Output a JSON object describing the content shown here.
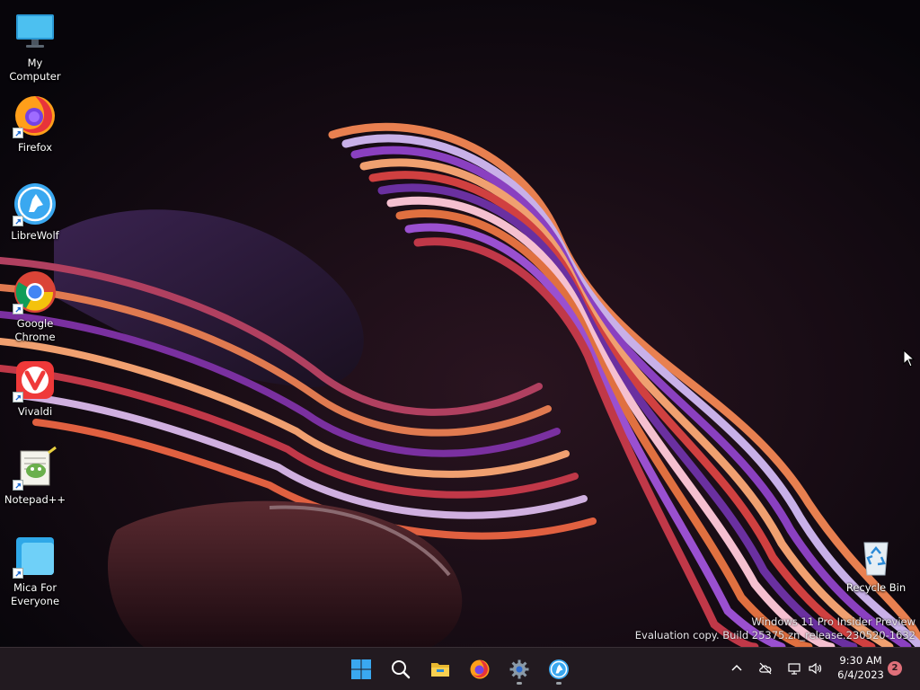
{
  "desktop": {
    "icons": [
      {
        "label": "My Computer",
        "icon": "monitor-icon"
      },
      {
        "label": "Firefox",
        "icon": "firefox-icon"
      },
      {
        "label": "LibreWolf",
        "icon": "librewolf-icon"
      },
      {
        "label": "Google\nChrome",
        "icon": "chrome-icon"
      },
      {
        "label": "Vivaldi",
        "icon": "vivaldi-icon"
      },
      {
        "label": "Notepad++",
        "icon": "notepadpp-icon"
      },
      {
        "label": "Mica For\nEveryone",
        "icon": "mica-icon"
      }
    ],
    "recycle_bin": {
      "label": "Recycle Bin",
      "icon": "recycle-bin-icon"
    }
  },
  "watermark": {
    "line1": "Windows 11 Pro Insider Preview",
    "line2": "Evaluation copy. Build 25375.zn_release.230520-1632"
  },
  "taskbar": {
    "buttons": [
      {
        "name": "start-button",
        "icon": "windows-logo-icon"
      },
      {
        "name": "search-button",
        "icon": "search-icon"
      },
      {
        "name": "file-explorer-button",
        "icon": "folder-icon"
      },
      {
        "name": "firefox-taskbar-button",
        "icon": "firefox-icon"
      },
      {
        "name": "settings-taskbar-button",
        "icon": "gear-icon",
        "running": true
      },
      {
        "name": "librewolf-taskbar-button",
        "icon": "librewolf-icon",
        "running": true
      }
    ],
    "tray": {
      "icons": [
        "chevron-up-icon",
        "cloud-offline-icon",
        "network-icon",
        "speaker-icon"
      ],
      "time": "9:30 AM",
      "date": "6/4/2023",
      "notification_count": "2"
    }
  },
  "colors": {
    "taskbar_bg": "#221a20",
    "accent_blue": "#3aa8f0",
    "badge": "#e0707a"
  }
}
